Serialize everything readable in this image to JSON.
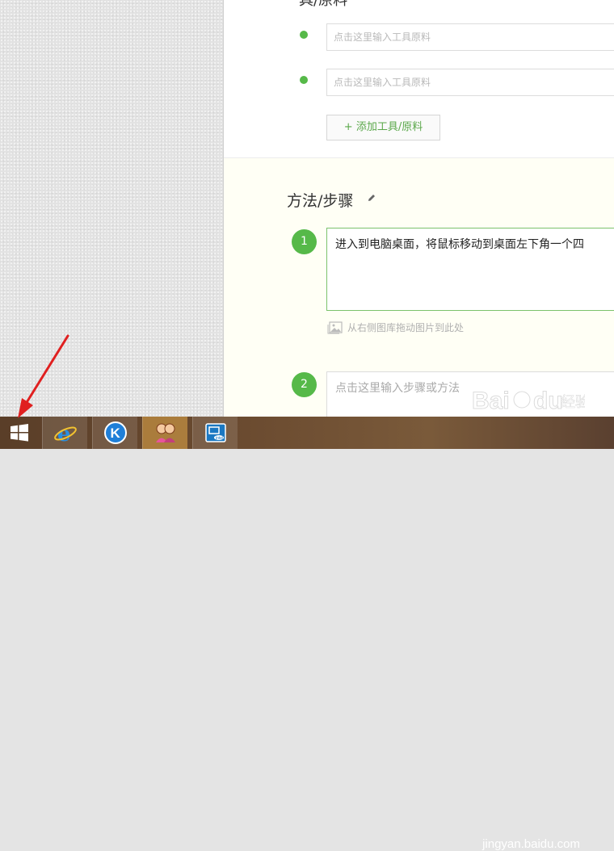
{
  "tools_section": {
    "title_fragment": "具/原料",
    "inputs": [
      {
        "placeholder": "点击这里输入工具原料"
      },
      {
        "placeholder": "点击这里输入工具原料"
      }
    ],
    "add_button": "+ 添加工具/原料"
  },
  "steps_section": {
    "title": "方法/步骤",
    "steps": [
      {
        "number": "1",
        "text": "进入到电脑桌面，将鼠标移动到桌面左下角一个四",
        "state": "active"
      },
      {
        "number": "2",
        "placeholder": "点击这里输入步骤或方法",
        "state": "empty"
      }
    ],
    "drag_hint": "从右侧图库拖动图片到此处"
  },
  "watermark": {
    "logo_text": "Baidu 经验",
    "url": "jingyan.baidu.com"
  },
  "taskbar": {
    "apps": [
      "start-button",
      "internet-explorer-icon",
      "kugou-music-icon",
      "qq-users-icon",
      "intel-widi-icon"
    ]
  },
  "colors": {
    "accent_green": "#56b949",
    "active_border": "#7cc26b",
    "panel_bg": "#fffff5"
  }
}
